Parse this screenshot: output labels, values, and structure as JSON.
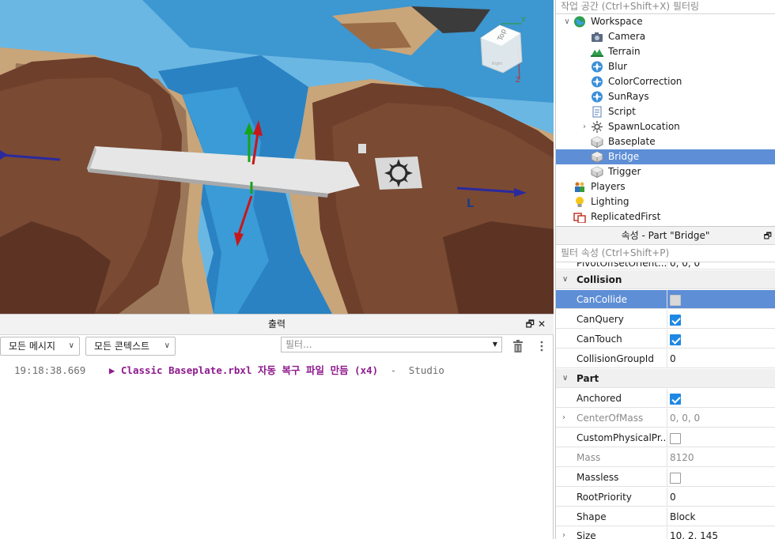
{
  "viewport": {
    "axis_y_label": "Y",
    "axis_z_label": "Z",
    "view_cube_label": "Top",
    "view_cube_sub_label": "Right",
    "cursor_label": "L"
  },
  "explorer": {
    "filter_placeholder": "작업 공간 (Ctrl+Shift+X) 필터링",
    "items": [
      {
        "label": "Workspace",
        "icon": "globe-icon",
        "level": 0,
        "expanded": true,
        "selected": false
      },
      {
        "label": "Camera",
        "icon": "camera-icon",
        "level": 1,
        "selected": false
      },
      {
        "label": "Terrain",
        "icon": "terrain-icon",
        "level": 1,
        "selected": false
      },
      {
        "label": "Blur",
        "icon": "post-effect-icon",
        "level": 1,
        "selected": false
      },
      {
        "label": "ColorCorrection",
        "icon": "post-effect-icon",
        "level": 1,
        "selected": false
      },
      {
        "label": "SunRays",
        "icon": "post-effect-icon",
        "level": 1,
        "selected": false
      },
      {
        "label": "Script",
        "icon": "script-icon",
        "level": 1,
        "selected": false
      },
      {
        "label": "SpawnLocation",
        "icon": "spawn-icon",
        "level": 1,
        "collapsed": true,
        "selected": false
      },
      {
        "label": "Baseplate",
        "icon": "part-icon",
        "level": 1,
        "selected": false
      },
      {
        "label": "Bridge",
        "icon": "part-icon",
        "level": 1,
        "selected": true
      },
      {
        "label": "Trigger",
        "icon": "part-icon",
        "level": 1,
        "selected": false
      },
      {
        "label": "Players",
        "icon": "players-icon",
        "level": 0,
        "selected": false
      },
      {
        "label": "Lighting",
        "icon": "lightbulb-icon",
        "level": 0,
        "selected": false
      },
      {
        "label": "ReplicatedFirst",
        "icon": "replicated-icon",
        "level": 0,
        "selected": false
      }
    ]
  },
  "properties": {
    "title": "속성 - Part \"Bridge\"",
    "filter_placeholder": "필터 속성 (Ctrl+Shift+P)",
    "partial_row": {
      "name": "PivotOffsetOrient...",
      "value": "0, 0, 0"
    },
    "sections": [
      {
        "name": "Collision",
        "rows": [
          {
            "name": "CanCollide",
            "type": "checkbox",
            "checked": false,
            "selected": true
          },
          {
            "name": "CanQuery",
            "type": "checkbox",
            "checked": true
          },
          {
            "name": "CanTouch",
            "type": "checkbox",
            "checked": true
          },
          {
            "name": "CollisionGroupId",
            "type": "text",
            "value": "0"
          }
        ]
      },
      {
        "name": "Part",
        "rows": [
          {
            "name": "Anchored",
            "type": "checkbox",
            "checked": true
          },
          {
            "name": "CenterOfMass",
            "type": "text",
            "value": "0, 0, 0",
            "disabled": true,
            "expandable": true
          },
          {
            "name": "CustomPhysicalPr...",
            "type": "checkbox",
            "checked": false
          },
          {
            "name": "Mass",
            "type": "text",
            "value": "8120",
            "disabled": true
          },
          {
            "name": "Massless",
            "type": "checkbox",
            "checked": false
          },
          {
            "name": "RootPriority",
            "type": "text",
            "value": "0"
          },
          {
            "name": "Shape",
            "type": "text",
            "value": "Block"
          }
        ]
      }
    ],
    "partial_bottom_row": {
      "name": "Size",
      "value": "10, 2, 145"
    }
  },
  "output": {
    "title": "출력",
    "message_filter": "모든 메시지",
    "context_filter": "모든 콘텍스트",
    "filter_placeholder": "필터...",
    "log": {
      "timestamp": "19:18:38.669",
      "arrow": "▶",
      "message": "Classic Baseplate.rbxl 자동 복구 파일 만듬 (x4)",
      "separator": "-",
      "source": "Studio"
    }
  },
  "colors": {
    "selection": "#5e8ed6",
    "checkbox": "#1e88e5",
    "log_message": "#8e1a8e",
    "water": "#2a82c2",
    "cliff": "#6e3f2b"
  }
}
